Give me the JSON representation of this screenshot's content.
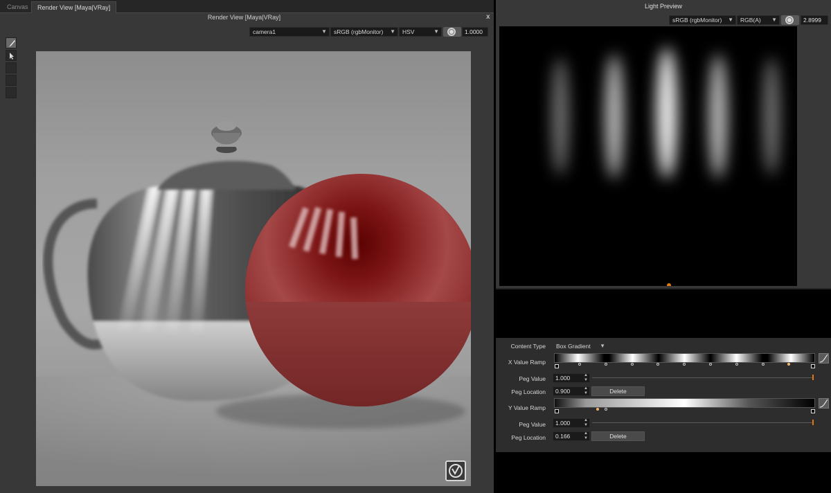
{
  "tabs": [
    {
      "label": "Canvas",
      "active": false
    },
    {
      "label": "Render View [Maya|VRay]",
      "active": true
    }
  ],
  "render_view": {
    "title": "Render View [Maya|VRay]",
    "close": "x",
    "camera": "camera1",
    "color_space": "sRGB (rgbMonitor)",
    "channel": "HSV",
    "exposure": "1.0000"
  },
  "light_preview": {
    "title": "Light Preview",
    "color_space": "sRGB (rgbMonitor)",
    "channel": "RGB(A)",
    "exposure": "2.8999"
  },
  "properties": {
    "content_type_label": "Content Type",
    "content_type_value": "Box Gradient",
    "x_ramp_label": "X Value Ramp",
    "x_peg_value_label": "Peg Value",
    "x_peg_value": "1.000",
    "x_peg_location_label": "Peg Location",
    "x_peg_location": "0.900",
    "x_delete": "Delete",
    "y_ramp_label": "Y Value Ramp",
    "y_peg_value_label": "Peg Value",
    "y_peg_value": "1.000",
    "y_peg_location_label": "Peg Location",
    "y_peg_location": "0.166",
    "y_delete": "Delete"
  },
  "colors": {
    "accent_orange": "#e07a10",
    "panel_bg": "#383838",
    "sphere_red": "#8e1c1c"
  }
}
